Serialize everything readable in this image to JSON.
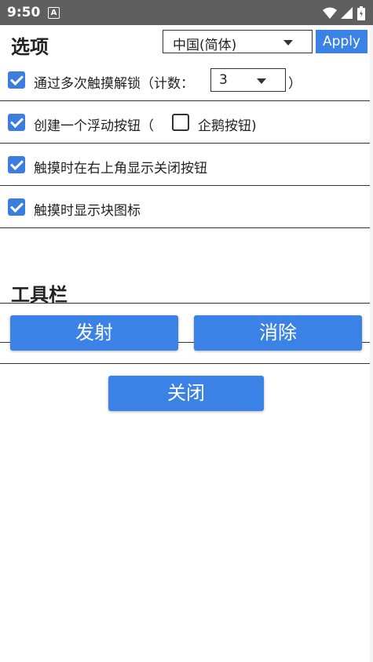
{
  "status_bar": {
    "time": "9:50",
    "notification": "A"
  },
  "header": {
    "title": "选项",
    "language_value": "中国(简体)",
    "apply_label": "Apply"
  },
  "options": [
    {
      "label": "通过多次触摸解锁（计数：",
      "checked": true,
      "count_value": "3",
      "suffix": "）"
    },
    {
      "label": "创建一个浮动按钮（",
      "checked": true,
      "sub_label": "企鹅按钮)",
      "sub_checked": false
    },
    {
      "label": "触摸时在右上角显示关闭按钮",
      "checked": true
    },
    {
      "label": "触摸时显示块图标",
      "checked": true
    }
  ],
  "toolbar": {
    "title": "工具栏",
    "launch_label": "发射",
    "clear_label": "消除"
  },
  "close_label": "关闭",
  "colors": {
    "accent": "#3b82e6",
    "status_bar": "#5f5f5f"
  }
}
